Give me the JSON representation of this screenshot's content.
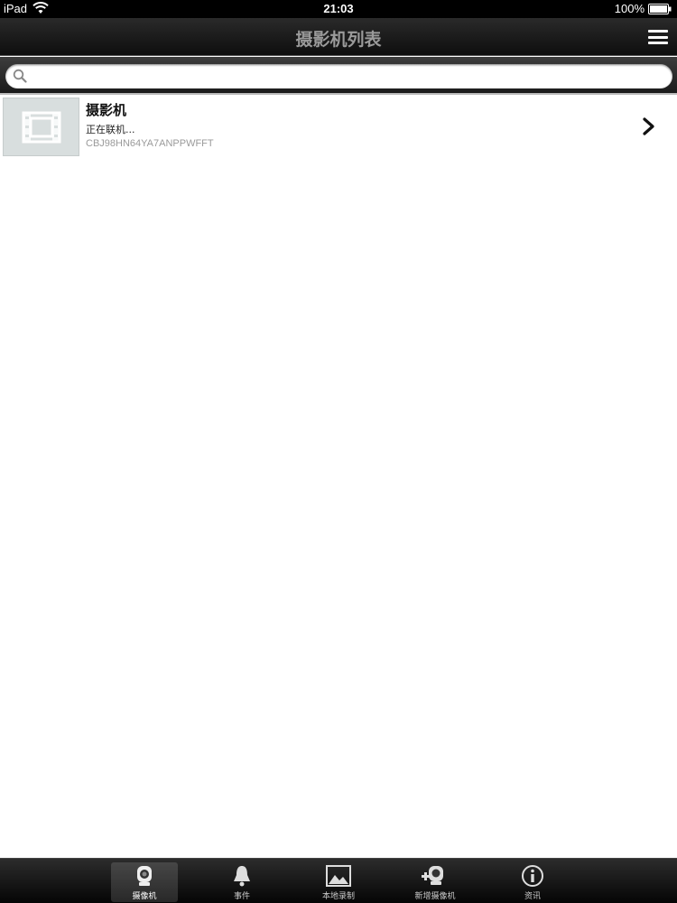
{
  "status_bar": {
    "device": "iPad",
    "time": "21:03",
    "battery": "100%"
  },
  "nav": {
    "title": "摄影机列表"
  },
  "search": {
    "placeholder": "",
    "value": ""
  },
  "cameras": [
    {
      "name": "摄影机",
      "status": "正在联机...",
      "id": "CBJ98HN64YA7ANPPWFFT"
    }
  ],
  "tabs": [
    {
      "label": "摄像机",
      "icon": "camera-icon",
      "active": true
    },
    {
      "label": "事件",
      "icon": "bell-icon",
      "active": false
    },
    {
      "label": "本地录制",
      "icon": "picture-icon",
      "active": false
    },
    {
      "label": "新增摄像机",
      "icon": "add-camera-icon",
      "active": false
    },
    {
      "label": "资讯",
      "icon": "info-icon",
      "active": false
    }
  ],
  "colors": {
    "nav_title": "#9a9a9a",
    "thumb_bg": "#d8dede",
    "id_text": "#9a9a9a"
  }
}
